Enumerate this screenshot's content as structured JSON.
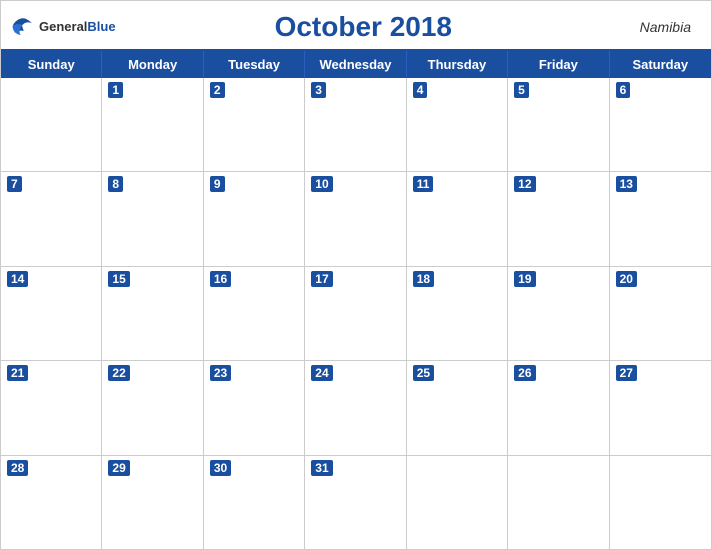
{
  "header": {
    "logo_general": "General",
    "logo_blue": "Blue",
    "month_year": "October 2018",
    "country": "Namibia"
  },
  "day_headers": [
    "Sunday",
    "Monday",
    "Tuesday",
    "Wednesday",
    "Thursday",
    "Friday",
    "Saturday"
  ],
  "weeks": [
    [
      {
        "day": "",
        "empty": true
      },
      {
        "day": "1"
      },
      {
        "day": "2"
      },
      {
        "day": "3"
      },
      {
        "day": "4"
      },
      {
        "day": "5"
      },
      {
        "day": "6"
      }
    ],
    [
      {
        "day": "7"
      },
      {
        "day": "8"
      },
      {
        "day": "9"
      },
      {
        "day": "10"
      },
      {
        "day": "11"
      },
      {
        "day": "12"
      },
      {
        "day": "13"
      }
    ],
    [
      {
        "day": "14"
      },
      {
        "day": "15"
      },
      {
        "day": "16"
      },
      {
        "day": "17"
      },
      {
        "day": "18"
      },
      {
        "day": "19"
      },
      {
        "day": "20"
      }
    ],
    [
      {
        "day": "21"
      },
      {
        "day": "22"
      },
      {
        "day": "23"
      },
      {
        "day": "24"
      },
      {
        "day": "25"
      },
      {
        "day": "26"
      },
      {
        "day": "27"
      }
    ],
    [
      {
        "day": "28"
      },
      {
        "day": "29"
      },
      {
        "day": "30"
      },
      {
        "day": "31"
      },
      {
        "day": "",
        "empty": true
      },
      {
        "day": "",
        "empty": true
      },
      {
        "day": "",
        "empty": true
      }
    ]
  ]
}
